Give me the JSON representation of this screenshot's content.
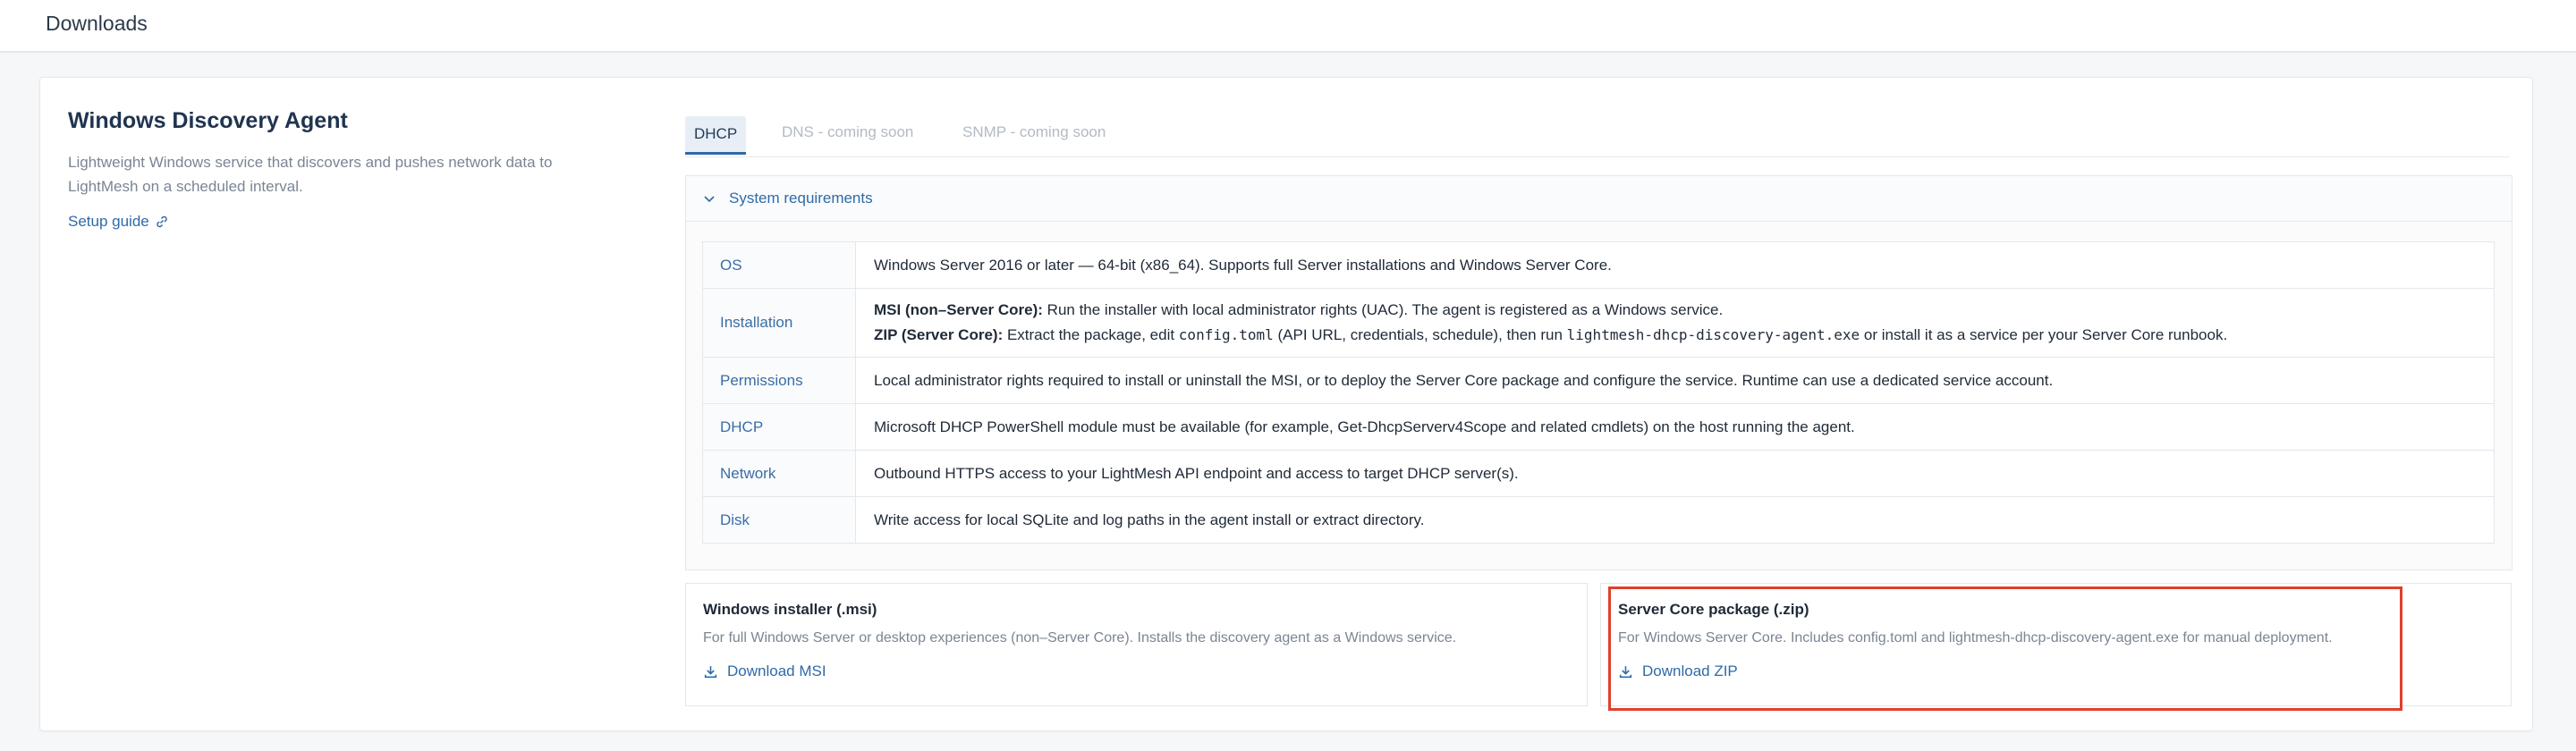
{
  "header": {
    "title": "Downloads"
  },
  "agent": {
    "title": "Windows Discovery Agent",
    "description": "Lightweight Windows service that discovers and pushes network data to LightMesh on a scheduled interval.",
    "setup_link": "Setup guide"
  },
  "tabs": [
    {
      "label": "DHCP",
      "state": "active"
    },
    {
      "label": "DNS - coming soon",
      "state": "disabled"
    },
    {
      "label": "SNMP - coming soon",
      "state": "disabled"
    }
  ],
  "requirements": {
    "header": "System requirements",
    "rows": [
      {
        "key": "OS",
        "value": "Windows Server 2016 or later — 64-bit (x86_64). Supports full Server installations and Windows Server Core."
      },
      {
        "key": "Installation",
        "line1_bold": "MSI (non–Server Core):",
        "line1_text": " Run the installer with local administrator rights (UAC). The agent is registered as a Windows service.",
        "line2_bold": "ZIP (Server Core):",
        "line2_text_a": " Extract the package, edit ",
        "line2_code_a": "config.toml",
        "line2_text_b": " (API URL, credentials, schedule), then run ",
        "line2_code_b": "lightmesh-dhcp-discovery-agent.exe",
        "line2_text_c": " or install it as a service per your Server Core runbook."
      },
      {
        "key": "Permissions",
        "value": "Local administrator rights required to install or uninstall the MSI, or to deploy the Server Core package and configure the service. Runtime can use a dedicated service account."
      },
      {
        "key": "DHCP",
        "value": "Microsoft DHCP PowerShell module must be available (for example, Get-DhcpServerv4Scope and related cmdlets) on the host running the agent."
      },
      {
        "key": "Network",
        "value": "Outbound HTTPS access to your LightMesh API endpoint and access to target DHCP server(s)."
      },
      {
        "key": "Disk",
        "value": "Write access for local SQLite and log paths in the agent install or extract directory."
      }
    ]
  },
  "downloads": {
    "msi": {
      "title": "Windows installer (.msi)",
      "description": "For full Windows Server or desktop experiences (non–Server Core). Installs the discovery agent as a Windows service.",
      "button": "Download MSI"
    },
    "zip": {
      "title": "Server Core package (.zip)",
      "description": "For Windows Server Core. Includes config.toml and lightmesh-dhcp-discovery-agent.exe for manual deployment.",
      "button": "Download ZIP"
    }
  },
  "colors": {
    "accent": "#2f6aa8",
    "highlight": "#e0402b"
  }
}
